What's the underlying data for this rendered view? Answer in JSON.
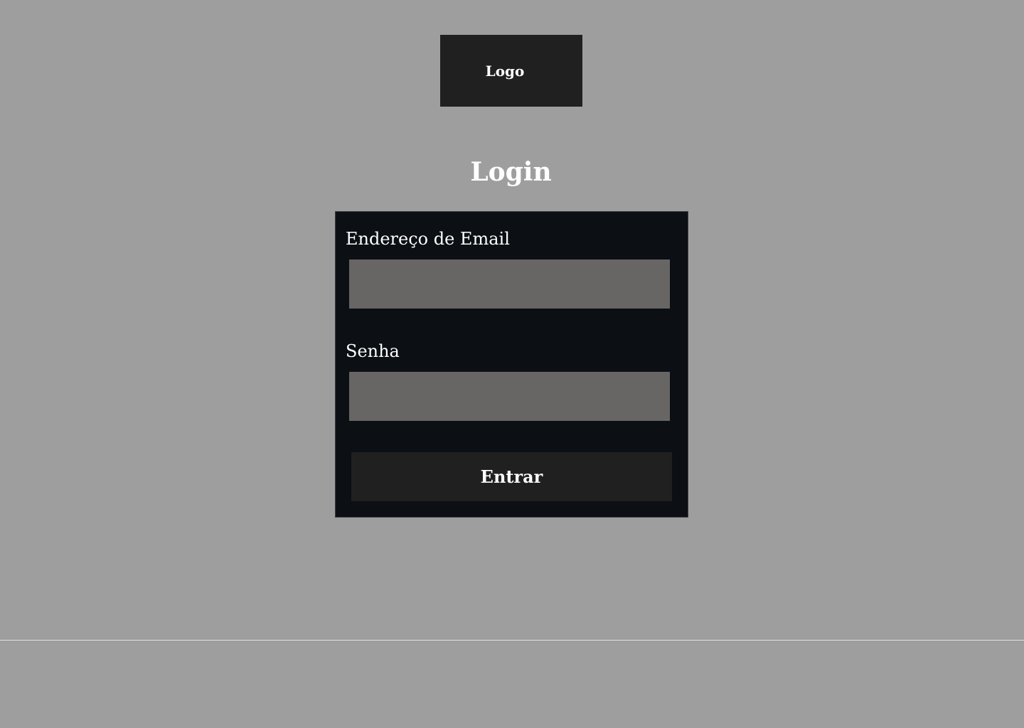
{
  "header": {
    "logo_text": "Logo"
  },
  "page": {
    "title": "Login"
  },
  "form": {
    "email_label": "Endereço de Email",
    "email_value": "",
    "password_label": "Senha",
    "password_value": "",
    "submit_label": "Entrar"
  },
  "colors": {
    "background": "#9e9e9e",
    "logo_box": "#202020",
    "card": "#0c0f14",
    "input": "#676664",
    "button": "#202020",
    "text": "#ffffff",
    "divider": "#e2e2e2"
  }
}
